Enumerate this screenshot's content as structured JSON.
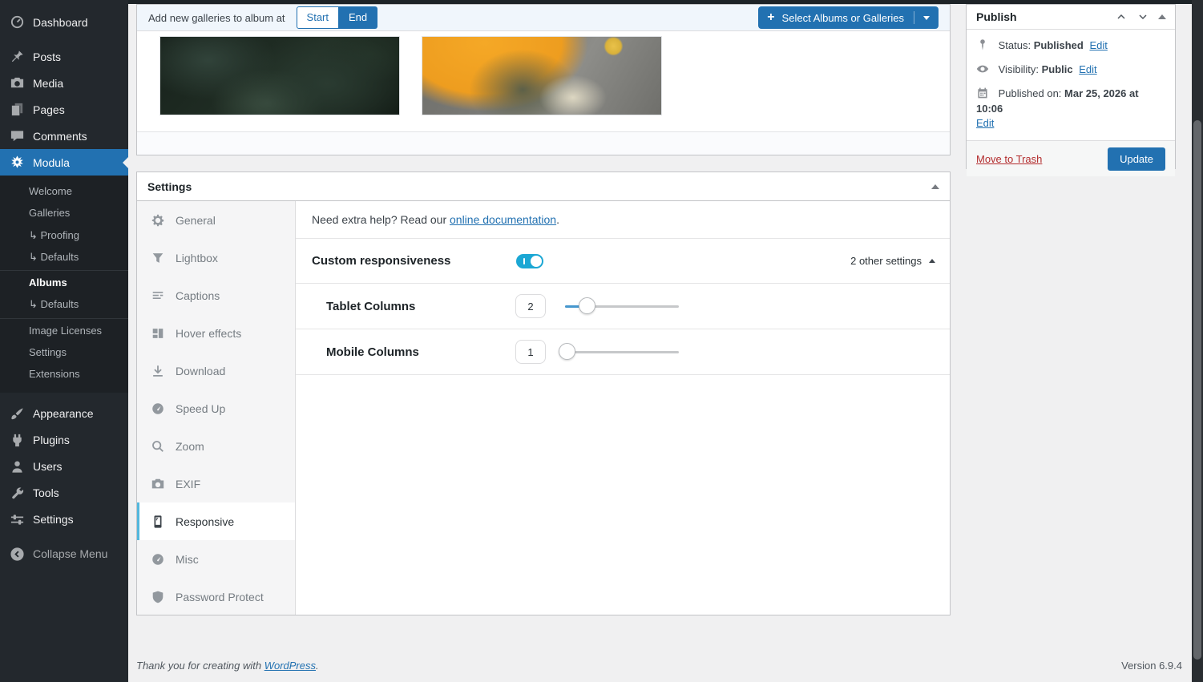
{
  "sidebar": {
    "items": [
      {
        "label": "Dashboard"
      },
      {
        "label": "Posts"
      },
      {
        "label": "Media"
      },
      {
        "label": "Pages"
      },
      {
        "label": "Comments"
      },
      {
        "label": "Modula"
      },
      {
        "label": "Appearance"
      },
      {
        "label": "Plugins"
      },
      {
        "label": "Users"
      },
      {
        "label": "Tools"
      },
      {
        "label": "Settings"
      },
      {
        "label": "Collapse Menu"
      }
    ],
    "submenu": [
      {
        "label": "Welcome"
      },
      {
        "label": "Galleries"
      },
      {
        "label": "↳ Proofing"
      },
      {
        "label": "↳ Defaults"
      },
      {
        "label": "Albums"
      },
      {
        "label": "↳ Defaults"
      },
      {
        "label": "Image Licenses"
      },
      {
        "label": "Settings"
      },
      {
        "label": "Extensions"
      }
    ]
  },
  "toolbar": {
    "label": "Add new galleries to album at",
    "start_label": "Start",
    "end_label": "End",
    "plus_glyph": "+",
    "select_albums_label": "Select Albums or Galleries"
  },
  "settings": {
    "title": "Settings",
    "tabs": [
      {
        "label": "General"
      },
      {
        "label": "Lightbox"
      },
      {
        "label": "Captions"
      },
      {
        "label": "Hover effects"
      },
      {
        "label": "Download"
      },
      {
        "label": "Speed Up"
      },
      {
        "label": "Zoom"
      },
      {
        "label": "EXIF"
      },
      {
        "label": "Responsive"
      },
      {
        "label": "Misc"
      },
      {
        "label": "Password Protect"
      }
    ],
    "help": {
      "prefix": "Need extra help? Read our ",
      "link": "online documentation",
      "suffix": "."
    },
    "custom_responsiveness": {
      "label": "Custom responsiveness",
      "other_settings": "2 other settings"
    },
    "tablet_columns": {
      "label": "Tablet Columns",
      "value": "2"
    },
    "mobile_columns": {
      "label": "Mobile Columns",
      "value": "1"
    }
  },
  "publish": {
    "title": "Publish",
    "status_label": "Status:",
    "status_value": "Published",
    "visibility_label": "Visibility:",
    "visibility_value": "Public",
    "published_label": "Published on:",
    "published_value": "Mar 25, 2026 at 10:06",
    "edit_label": "Edit",
    "move_to_trash_label": "Move to Trash",
    "update_label": "Update"
  },
  "footer": {
    "thanks_prefix": "Thank you for creating with ",
    "wordpress_link": "WordPress",
    "thanks_suffix": ".",
    "version": "Version 6.9.4"
  },
  "colors": {
    "accent_blue": "#2271b1",
    "toggle_cyan": "#1ba7d4",
    "active_tab_border": "#52b7dd",
    "trash_red": "#b32d2e",
    "admin_menu_bg": "#23282d"
  }
}
